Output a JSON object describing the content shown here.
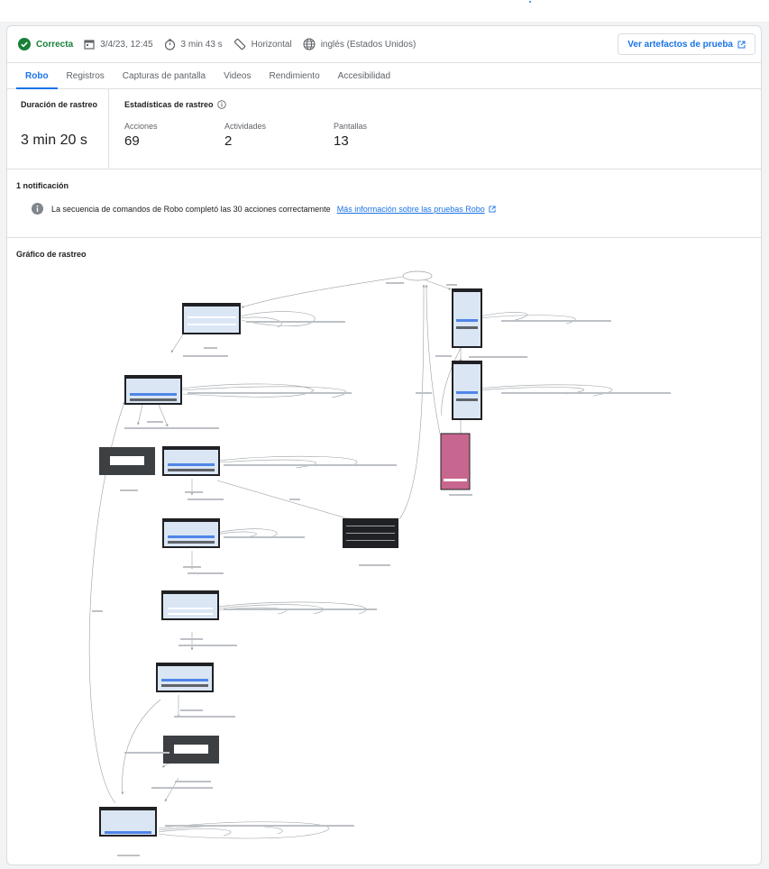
{
  "status": {
    "result": "Correcta",
    "date": "3/4/23, 12:45",
    "duration": "3 min 43 s",
    "orientation": "Horizontal",
    "locale": "inglés (Estados Unidos)",
    "artifacts_button": "Ver artefactos de prueba"
  },
  "tabs": [
    "Robo",
    "Registros",
    "Capturas de pantalla",
    "Videos",
    "Rendimiento",
    "Accesibilidad"
  ],
  "stats": {
    "duration_label": "Duración de rastreo",
    "duration_value": "3 min 20 s",
    "crawl_title": "Estadísticas de rastreo",
    "actions_label": "Acciones",
    "actions_value": "69",
    "activities_label": "Actividades",
    "activities_value": "2",
    "screens_label": "Pantallas",
    "screens_value": "13"
  },
  "notification": {
    "title": "1 notificación",
    "message": "La secuencia de comandos de Robo completó las 30 acciones correctamente",
    "link": "Más información sobre las pruebas Robo"
  },
  "graph": {
    "title": "Gráfico de rastreo"
  },
  "colors": {
    "accent": "#1a73e8",
    "success": "#188038",
    "border": "#dadce0"
  }
}
